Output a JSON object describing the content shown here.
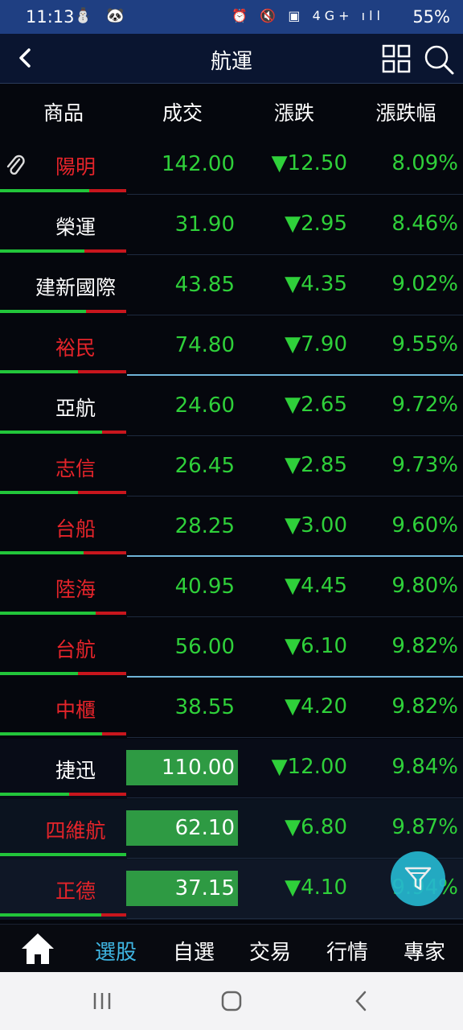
{
  "status_bar": {
    "time": "11:13",
    "battery": "55%",
    "left_icons": "⛄ 🐼",
    "right_icons": "⏰ 🔇 ▣ 4G+ ıll"
  },
  "header": {
    "title": "航運"
  },
  "columns": [
    "商品",
    "成交",
    "漲跌",
    "漲跌幅"
  ],
  "rows": [
    {
      "name": "陽明",
      "name_color": "red",
      "price": "142.00",
      "change": "▼12.50",
      "pct": "8.09%",
      "highlight": false,
      "pinned": true,
      "green_ratio": 0.71,
      "separator_highlight": false
    },
    {
      "name": "榮運",
      "name_color": "white",
      "price": "31.90",
      "change": "▼2.95",
      "pct": "8.46%",
      "highlight": false,
      "pinned": false,
      "green_ratio": 0.67,
      "separator_highlight": false
    },
    {
      "name": "建新國際",
      "name_color": "white",
      "price": "43.85",
      "change": "▼4.35",
      "pct": "9.02%",
      "highlight": false,
      "pinned": false,
      "green_ratio": 0.68,
      "separator_highlight": false
    },
    {
      "name": "裕民",
      "name_color": "red",
      "price": "74.80",
      "change": "▼7.90",
      "pct": "9.55%",
      "highlight": false,
      "pinned": false,
      "green_ratio": 0.62,
      "separator_highlight": true
    },
    {
      "name": "亞航",
      "name_color": "white",
      "price": "24.60",
      "change": "▼2.65",
      "pct": "9.72%",
      "highlight": false,
      "pinned": false,
      "green_ratio": 0.81,
      "separator_highlight": false
    },
    {
      "name": "志信",
      "name_color": "red",
      "price": "26.45",
      "change": "▼2.85",
      "pct": "9.73%",
      "highlight": false,
      "pinned": false,
      "green_ratio": 0.62,
      "separator_highlight": false
    },
    {
      "name": "台船",
      "name_color": "red",
      "price": "28.25",
      "change": "▼3.00",
      "pct": "9.60%",
      "highlight": false,
      "pinned": false,
      "green_ratio": 0.66,
      "separator_highlight": true
    },
    {
      "name": "陸海",
      "name_color": "red",
      "price": "40.95",
      "change": "▼4.45",
      "pct": "9.80%",
      "highlight": false,
      "pinned": false,
      "green_ratio": 0.76,
      "separator_highlight": false
    },
    {
      "name": "台航",
      "name_color": "red",
      "price": "56.00",
      "change": "▼6.10",
      "pct": "9.82%",
      "highlight": false,
      "pinned": false,
      "green_ratio": 0.62,
      "separator_highlight": true
    },
    {
      "name": "中櫃",
      "name_color": "red",
      "price": "38.55",
      "change": "▼4.20",
      "pct": "9.82%",
      "highlight": false,
      "pinned": false,
      "green_ratio": 0.81,
      "separator_highlight": false
    },
    {
      "name": "捷迅",
      "name_color": "white",
      "price": "110.00",
      "change": "▼12.00",
      "pct": "9.84%",
      "highlight": true,
      "pinned": false,
      "green_ratio": 0.55,
      "separator_highlight": false
    },
    {
      "name": "四維航",
      "name_color": "red",
      "price": "62.10",
      "change": "▼6.80",
      "pct": "9.87%",
      "highlight": true,
      "pinned": false,
      "green_ratio": 1.0,
      "separator_highlight": false
    },
    {
      "name": "正德",
      "name_color": "red",
      "price": "37.15",
      "change": "▼4.10",
      "pct": "9.94%",
      "highlight": true,
      "pinned": false,
      "green_ratio": 0.8,
      "separator_highlight": false
    }
  ],
  "bottom_nav": {
    "tabs": [
      "選股",
      "自選",
      "交易",
      "行情",
      "專家"
    ],
    "active": "選股"
  },
  "colors": {
    "up_red": "#e5242a",
    "down_green": "#2fd03a",
    "accent": "#3fb6e3",
    "header_bg": "#0a1530",
    "status_bg": "#1f3f82"
  },
  "icons": {
    "back": "chevron-left-icon",
    "grid": "grid-icon",
    "search": "search-icon",
    "filter": "filter-icon",
    "home": "home-icon",
    "pin": "paperclip-icon"
  }
}
